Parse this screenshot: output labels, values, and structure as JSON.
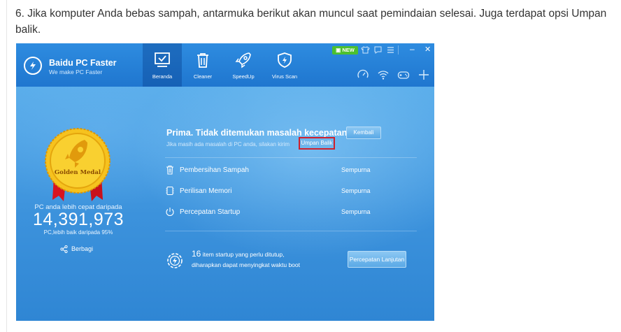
{
  "caption": "6. Jika komputer Anda bebas sampah, antarmuka berikut akan muncul saat pemindaian selesai. Juga terdapat opsi Umpan balik.",
  "app": {
    "brand_name": "Baidu PC Faster",
    "brand_tagline": "We make PC Faster",
    "new_badge": "NEW",
    "tabs": [
      {
        "label": "Beranda",
        "icon": "monitor-check-icon"
      },
      {
        "label": "Cleaner",
        "icon": "trash-icon"
      },
      {
        "label": "SpeedUp",
        "icon": "rocket-icon"
      },
      {
        "label": "Virus Scan",
        "icon": "shield-icon"
      }
    ],
    "window_controls": {
      "minimize": "–",
      "close": "✕"
    }
  },
  "score": {
    "medal_text": "Golden Medal",
    "label": "PC anda lebih cepat daripada",
    "value": "14,391,973",
    "sub": "PC,lebih baik daripada  95%",
    "share_label": "Berbagi"
  },
  "result": {
    "title": "Prima. Tidak ditemukan masalah kecepatan!",
    "description": "Jika masih ada masalah di PC anda, silakan kirim",
    "feedback_link": "Umpan Balik",
    "back_button": "Kembali",
    "items": [
      {
        "label": "Pembersihan Sampah",
        "status": "Sempurna",
        "icon": "trash-icon"
      },
      {
        "label": "Perilisan Memori",
        "status": "Sempurna",
        "icon": "memory-icon"
      },
      {
        "label": "Percepatan Startup",
        "status": "Sempurna",
        "icon": "power-icon"
      }
    ],
    "startup_count": "16",
    "startup_line1": " item startup yang perlu ditutup,",
    "startup_line2": "diharapkan dapat menyingkat waktu boot",
    "advanced_button": "Percepatan Lanjutan"
  },
  "colors": {
    "titlebar": "#2583d8",
    "content_bg": "#4a9fe3",
    "feedback_highlight": "#d0202c",
    "new_badge": "#4cc02f",
    "medal_gold": "#f4b818"
  }
}
